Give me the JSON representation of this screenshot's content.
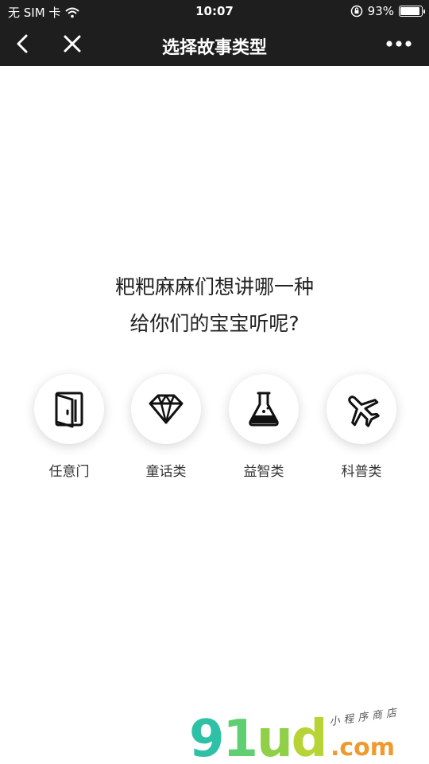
{
  "status_bar": {
    "carrier": "无 SIM 卡",
    "time": "10:07",
    "battery_percent": "93%",
    "battery_level": 0.93
  },
  "nav": {
    "title": "选择故事类型"
  },
  "question": {
    "line1": "粑粑麻麻们想讲哪一种",
    "line2": "给你们的宝宝听呢?"
  },
  "categories": [
    {
      "label": "任意门",
      "icon": "door-icon"
    },
    {
      "label": "童话类",
      "icon": "diamond-icon"
    },
    {
      "label": "益智类",
      "icon": "flask-icon"
    },
    {
      "label": "科普类",
      "icon": "airplane-icon"
    }
  ],
  "watermark": {
    "logo": "91ud",
    "domain": ".com",
    "tagline": "小程序商店"
  },
  "colors": {
    "bar_bg": "#1e1e1e",
    "text_dark": "#222222"
  }
}
